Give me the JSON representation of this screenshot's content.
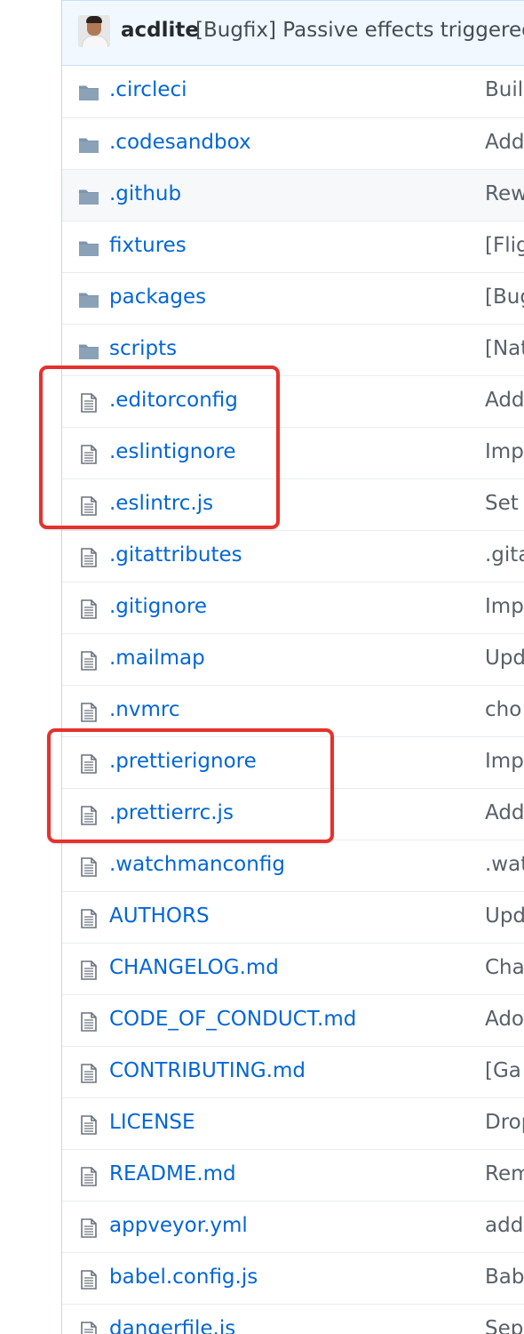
{
  "commit": {
    "author": "acdlite",
    "message": "[Bugfix] Passive effects triggered"
  },
  "files": [
    {
      "type": "dir",
      "icon": "folder-icon",
      "name": ".circleci",
      "message": "Buil"
    },
    {
      "type": "dir",
      "icon": "folder-icon",
      "name": ".codesandbox",
      "message": "Add"
    },
    {
      "type": "dir",
      "icon": "folder-icon",
      "name": ".github",
      "message": "Rew"
    },
    {
      "type": "dir",
      "icon": "folder-icon",
      "name": "fixtures",
      "message": "[Flig"
    },
    {
      "type": "dir",
      "icon": "folder-icon",
      "name": "packages",
      "message": "[Bug"
    },
    {
      "type": "dir",
      "icon": "folder-icon",
      "name": "scripts",
      "message": "[Nat"
    },
    {
      "type": "file",
      "icon": "file-icon",
      "name": ".editorconfig",
      "message": "Add"
    },
    {
      "type": "file",
      "icon": "file-icon",
      "name": ".eslintignore",
      "message": "Imp"
    },
    {
      "type": "file",
      "icon": "file-icon",
      "name": ".eslintrc.js",
      "message": "Set"
    },
    {
      "type": "file",
      "icon": "file-icon",
      "name": ".gitattributes",
      "message": ".gita"
    },
    {
      "type": "file",
      "icon": "file-icon",
      "name": ".gitignore",
      "message": "Imp"
    },
    {
      "type": "file",
      "icon": "file-icon",
      "name": ".mailmap",
      "message": "Upd"
    },
    {
      "type": "file",
      "icon": "file-icon",
      "name": ".nvmrc",
      "message": "cho"
    },
    {
      "type": "file",
      "icon": "file-icon",
      "name": ".prettierignore",
      "message": "Imp"
    },
    {
      "type": "file",
      "icon": "file-icon",
      "name": ".prettierrc.js",
      "message": "Add"
    },
    {
      "type": "file",
      "icon": "file-icon",
      "name": ".watchmanconfig",
      "message": ".wat"
    },
    {
      "type": "file",
      "icon": "file-icon",
      "name": "AUTHORS",
      "message": "Upd"
    },
    {
      "type": "file",
      "icon": "file-icon",
      "name": "CHANGELOG.md",
      "message": "Cha"
    },
    {
      "type": "file",
      "icon": "file-icon",
      "name": "CODE_OF_CONDUCT.md",
      "message": "Ado"
    },
    {
      "type": "file",
      "icon": "file-icon",
      "name": "CONTRIBUTING.md",
      "message": "[Ga"
    },
    {
      "type": "file",
      "icon": "file-icon",
      "name": "LICENSE",
      "message": "Drop"
    },
    {
      "type": "file",
      "icon": "file-icon",
      "name": "README.md",
      "message": "Rem"
    },
    {
      "type": "file",
      "icon": "file-icon",
      "name": "appveyor.yml",
      "message": "add"
    },
    {
      "type": "file",
      "icon": "file-icon",
      "name": "babel.config.js",
      "message": "Bab"
    },
    {
      "type": "file",
      "icon": "file-icon",
      "name": "dangerfile.js",
      "message": "Sep"
    }
  ],
  "colors": {
    "link": "#0366d6",
    "folder": "#79b8ff",
    "highlight": "#e4322d",
    "commit_bar": "#f1f8ff"
  }
}
